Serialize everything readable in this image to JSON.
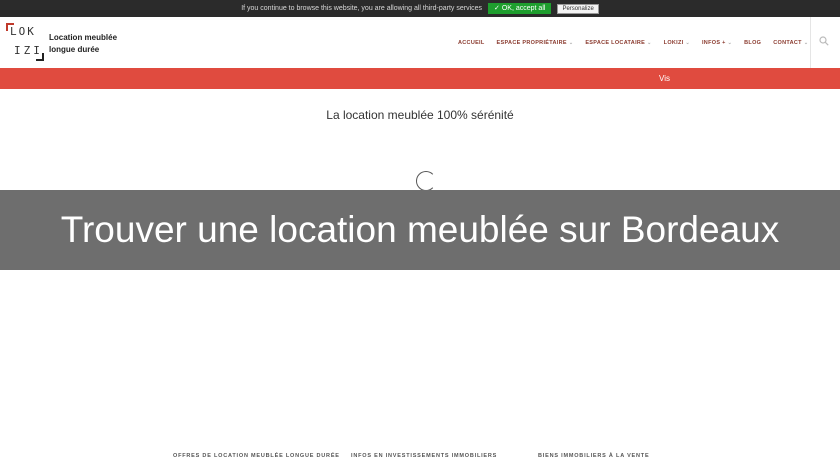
{
  "cookie": {
    "text": "If you continue to browse this website, you are allowing all third-party services",
    "ok_label": "✓ OK, accept all",
    "personalize_label": "Personalize"
  },
  "header": {
    "logo_line1": "LOK",
    "logo_line2": "IZI",
    "tagline_line1": "Location meublée",
    "tagline_line2": "longue durée"
  },
  "nav": {
    "items": [
      {
        "label": "ACCUEIL",
        "chevron": ""
      },
      {
        "label": "ESPACE PROPRIÉTAIRE",
        "chevron": "⌄"
      },
      {
        "label": "ESPACE LOCATAIRE",
        "chevron": "⌄"
      },
      {
        "label": "LOKIZI",
        "chevron": "⌄"
      },
      {
        "label": "INFOS +",
        "chevron": "⌄"
      },
      {
        "label": "BLOG",
        "chevron": ""
      },
      {
        "label": "CONTACT",
        "chevron": "⌄"
      }
    ]
  },
  "red_bar": {
    "text": "Vis"
  },
  "main": {
    "subtitle": "La location meublée 100% sérénité",
    "banner_title": "Trouver une location meublée sur Bordeaux"
  },
  "footer": {
    "links": [
      "OFFRES DE LOCATION MEUBLÉE LONGUE DURÉE",
      "INFOS EN INVESTISSEMENTS IMMOBILIERS",
      "BIENS IMMOBILIERS À LA VENTE"
    ]
  },
  "colors": {
    "accent": "#e04b3f",
    "nav_text": "#8a3a2e",
    "ok_green": "#1e9e2e"
  }
}
